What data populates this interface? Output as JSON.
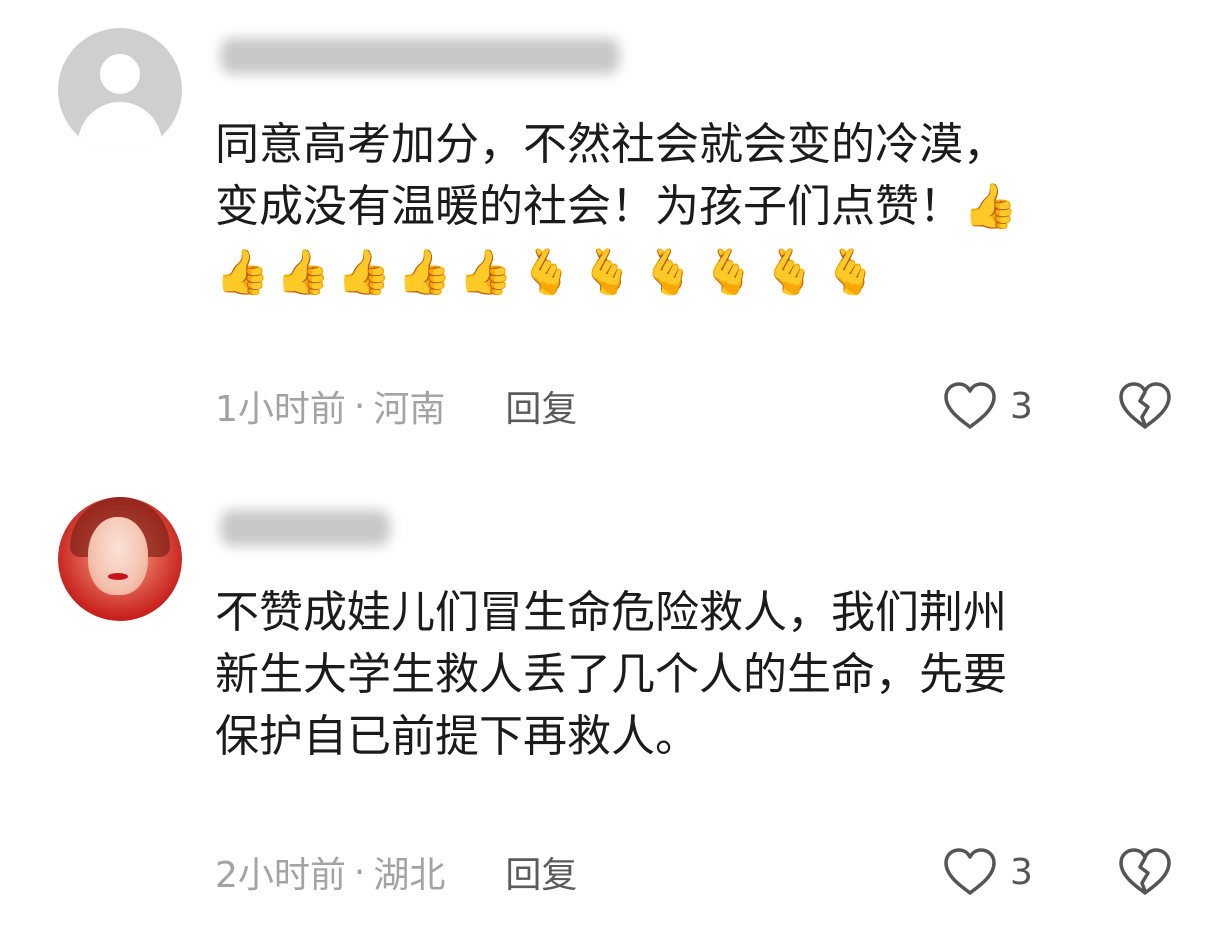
{
  "comments": [
    {
      "text_lines": [
        "同意高考加分，不然社会就会变的冷漠，",
        "变成没有温暖的社会！为孩子们点赞！👍"
      ],
      "emoji_line": [
        "👍",
        "👍",
        "👍",
        "👍",
        "👍",
        "🫰",
        "🫰",
        "🫰",
        "🫰",
        "🫰",
        "🫰"
      ],
      "time": "1小时前",
      "separator": "·",
      "location": "河南",
      "reply_label": "回复",
      "like_count": "3"
    },
    {
      "text_lines": [
        "不赞成娃儿们冒生命危险救人，我们荆州",
        "新生大学生救人丢了几个人的生命，先要",
        "保护自已前提下再救人。"
      ],
      "time": "2小时前",
      "separator": "·",
      "location": "湖北",
      "reply_label": "回复",
      "like_count": "3"
    }
  ],
  "icons": {
    "like": "heart-outline-icon",
    "dislike": "broken-heart-icon",
    "avatar_default": "default-avatar-icon"
  },
  "colors": {
    "text": "#1b1b1b",
    "meta": "#a3a3a3",
    "reply": "#5b5b5b",
    "icon_stroke": "#555555"
  }
}
